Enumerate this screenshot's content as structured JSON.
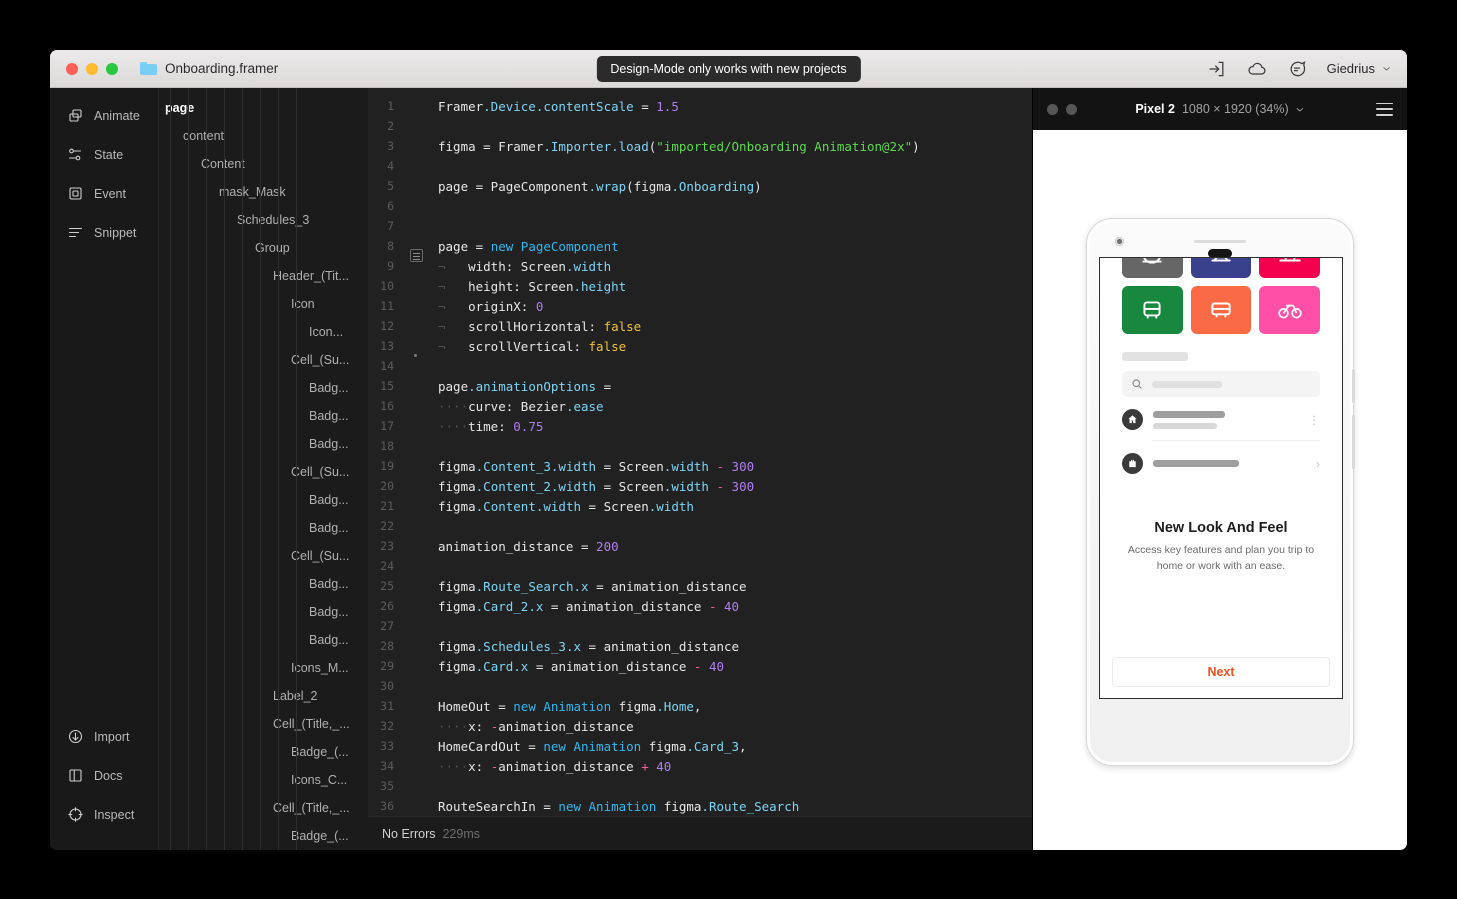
{
  "titlebar": {
    "document_name": "Onboarding.framer",
    "mode_notice": "Design-Mode only works with new projects",
    "icons": [
      "export-icon",
      "cloud-icon",
      "comment-icon"
    ],
    "user_name": "Giedrius"
  },
  "rail": {
    "top_items": [
      {
        "label": "Animate",
        "icon": "animate-icon"
      },
      {
        "label": "State",
        "icon": "state-icon"
      },
      {
        "label": "Event",
        "icon": "event-icon"
      },
      {
        "label": "Snippet",
        "icon": "snippet-icon"
      }
    ],
    "bottom_items": [
      {
        "label": "Import",
        "icon": "import-icon"
      },
      {
        "label": "Docs",
        "icon": "docs-icon"
      },
      {
        "label": "Inspect",
        "icon": "inspect-icon"
      }
    ]
  },
  "tree": {
    "items": [
      {
        "label": "page",
        "depth": 0,
        "root": true
      },
      {
        "label": "content",
        "depth": 1
      },
      {
        "label": "Content",
        "depth": 2
      },
      {
        "label": "mask_Mask",
        "depth": 3
      },
      {
        "label": "Schedules_3",
        "depth": 4
      },
      {
        "label": "Group",
        "depth": 5
      },
      {
        "label": "Header_(Tit...",
        "depth": 6
      },
      {
        "label": "Icon",
        "depth": 7
      },
      {
        "label": "Icon...",
        "depth": 8
      },
      {
        "label": "Cell_(Su...",
        "depth": 7
      },
      {
        "label": "Badg...",
        "depth": 8
      },
      {
        "label": "Badg...",
        "depth": 8
      },
      {
        "label": "Badg...",
        "depth": 8
      },
      {
        "label": "Cell_(Su...",
        "depth": 7
      },
      {
        "label": "Badg...",
        "depth": 8
      },
      {
        "label": "Badg...",
        "depth": 8
      },
      {
        "label": "Cell_(Su...",
        "depth": 7
      },
      {
        "label": "Badg...",
        "depth": 8
      },
      {
        "label": "Badg...",
        "depth": 8
      },
      {
        "label": "Badg...",
        "depth": 8
      },
      {
        "label": "Icons_M...",
        "depth": 7
      },
      {
        "label": "Label_2",
        "depth": 6
      },
      {
        "label": "Cell_(Title,_...",
        "depth": 6
      },
      {
        "label": "Badge_(...",
        "depth": 7
      },
      {
        "label": "Icons_C...",
        "depth": 7
      },
      {
        "label": "Cell_(Title,_...",
        "depth": 6
      },
      {
        "label": "Badge_(...",
        "depth": 7
      }
    ]
  },
  "editor": {
    "lines": [
      {
        "n": 1,
        "tokens": [
          [
            "plain",
            "Framer"
          ],
          [
            "prop",
            ".Device"
          ],
          [
            "prop",
            ".contentScale"
          ],
          [
            "plain",
            " = "
          ],
          [
            "num",
            "1.5"
          ]
        ]
      },
      {
        "n": 2,
        "tokens": []
      },
      {
        "n": 3,
        "tokens": [
          [
            "plain",
            "figma = Framer"
          ],
          [
            "prop",
            ".Importer"
          ],
          [
            "prop",
            ".load"
          ],
          [
            "plain",
            "("
          ],
          [
            "str",
            "\"imported/Onboarding Animation@2x\""
          ],
          [
            "plain",
            ")"
          ]
        ]
      },
      {
        "n": 4,
        "tokens": []
      },
      {
        "n": 5,
        "tokens": [
          [
            "plain",
            "page = PageComponent"
          ],
          [
            "prop",
            ".wrap"
          ],
          [
            "plain",
            "(figma"
          ],
          [
            "prop",
            ".Onboarding"
          ],
          [
            "plain",
            ")"
          ]
        ]
      },
      {
        "n": 6,
        "tokens": []
      },
      {
        "n": 7,
        "tokens": []
      },
      {
        "n": 8,
        "tokens": [
          [
            "plain",
            "page = "
          ],
          [
            "kw",
            "new"
          ],
          [
            "plain",
            " "
          ],
          [
            "kw",
            "PageComponent"
          ]
        ],
        "fold": "start"
      },
      {
        "n": 9,
        "tokens": [
          [
            "inv",
            "¬"
          ],
          [
            "plain",
            "   width: Screen"
          ],
          [
            "prop",
            ".width"
          ]
        ],
        "fold": "mid"
      },
      {
        "n": 10,
        "tokens": [
          [
            "inv",
            "¬"
          ],
          [
            "plain",
            "   height: Screen"
          ],
          [
            "prop",
            ".height"
          ]
        ],
        "fold": "mid"
      },
      {
        "n": 11,
        "tokens": [
          [
            "inv",
            "¬"
          ],
          [
            "plain",
            "   originX: "
          ],
          [
            "num",
            "0"
          ]
        ],
        "fold": "mid"
      },
      {
        "n": 12,
        "tokens": [
          [
            "inv",
            "¬"
          ],
          [
            "plain",
            "   scrollHorizontal: "
          ],
          [
            "bool",
            "false"
          ]
        ],
        "fold": "mid"
      },
      {
        "n": 13,
        "tokens": [
          [
            "inv",
            "¬"
          ],
          [
            "plain",
            "   scrollVertical: "
          ],
          [
            "bool",
            "false"
          ]
        ],
        "fold": "end"
      },
      {
        "n": 14,
        "tokens": []
      },
      {
        "n": 15,
        "tokens": [
          [
            "plain",
            "page"
          ],
          [
            "prop",
            ".animationOptions"
          ],
          [
            "plain",
            " ="
          ]
        ]
      },
      {
        "n": 16,
        "tokens": [
          [
            "inv",
            "····"
          ],
          [
            "plain",
            "curve: Bezier"
          ],
          [
            "prop",
            ".ease"
          ]
        ]
      },
      {
        "n": 17,
        "tokens": [
          [
            "inv",
            "····"
          ],
          [
            "plain",
            "time: "
          ],
          [
            "num",
            "0.75"
          ]
        ]
      },
      {
        "n": 18,
        "tokens": []
      },
      {
        "n": 19,
        "tokens": [
          [
            "plain",
            "figma"
          ],
          [
            "prop",
            ".Content_3"
          ],
          [
            "prop",
            ".width"
          ],
          [
            "plain",
            " = Screen"
          ],
          [
            "prop",
            ".width"
          ],
          [
            "plain",
            " "
          ],
          [
            "op",
            "-"
          ],
          [
            "plain",
            " "
          ],
          [
            "num",
            "300"
          ]
        ]
      },
      {
        "n": 20,
        "tokens": [
          [
            "plain",
            "figma"
          ],
          [
            "prop",
            ".Content_2"
          ],
          [
            "prop",
            ".width"
          ],
          [
            "plain",
            " = Screen"
          ],
          [
            "prop",
            ".width"
          ],
          [
            "plain",
            " "
          ],
          [
            "op",
            "-"
          ],
          [
            "plain",
            " "
          ],
          [
            "num",
            "300"
          ]
        ]
      },
      {
        "n": 21,
        "tokens": [
          [
            "plain",
            "figma"
          ],
          [
            "prop",
            ".Content"
          ],
          [
            "prop",
            ".width"
          ],
          [
            "plain",
            " = Screen"
          ],
          [
            "prop",
            ".width"
          ]
        ]
      },
      {
        "n": 22,
        "tokens": []
      },
      {
        "n": 23,
        "tokens": [
          [
            "plain",
            "animation_distance = "
          ],
          [
            "num",
            "200"
          ]
        ]
      },
      {
        "n": 24,
        "tokens": []
      },
      {
        "n": 25,
        "tokens": [
          [
            "plain",
            "figma"
          ],
          [
            "prop",
            ".Route_Search"
          ],
          [
            "prop",
            ".x"
          ],
          [
            "plain",
            " = animation_distance"
          ]
        ]
      },
      {
        "n": 26,
        "tokens": [
          [
            "plain",
            "figma"
          ],
          [
            "prop",
            ".Card_2"
          ],
          [
            "prop",
            ".x"
          ],
          [
            "plain",
            " = animation_distance "
          ],
          [
            "op",
            "-"
          ],
          [
            "plain",
            " "
          ],
          [
            "num",
            "40"
          ]
        ]
      },
      {
        "n": 27,
        "tokens": []
      },
      {
        "n": 28,
        "tokens": [
          [
            "plain",
            "figma"
          ],
          [
            "prop",
            ".Schedules_3"
          ],
          [
            "prop",
            ".x"
          ],
          [
            "plain",
            " = animation_distance"
          ]
        ]
      },
      {
        "n": 29,
        "tokens": [
          [
            "plain",
            "figma"
          ],
          [
            "prop",
            ".Card"
          ],
          [
            "prop",
            ".x"
          ],
          [
            "plain",
            " = animation_distance "
          ],
          [
            "op",
            "-"
          ],
          [
            "plain",
            " "
          ],
          [
            "num",
            "40"
          ]
        ]
      },
      {
        "n": 30,
        "tokens": []
      },
      {
        "n": 31,
        "tokens": [
          [
            "plain",
            "HomeOut = "
          ],
          [
            "kw",
            "new"
          ],
          [
            "plain",
            " "
          ],
          [
            "kw",
            "Animation"
          ],
          [
            "plain",
            " figma"
          ],
          [
            "prop",
            ".Home"
          ],
          [
            "plain",
            ","
          ]
        ]
      },
      {
        "n": 32,
        "tokens": [
          [
            "inv",
            "····"
          ],
          [
            "plain",
            "x: "
          ],
          [
            "op",
            "-"
          ],
          [
            "plain",
            "animation_distance"
          ]
        ]
      },
      {
        "n": 33,
        "tokens": [
          [
            "plain",
            "HomeCardOut = "
          ],
          [
            "kw",
            "new"
          ],
          [
            "plain",
            " "
          ],
          [
            "kw",
            "Animation"
          ],
          [
            "plain",
            " figma"
          ],
          [
            "prop",
            ".Card_3"
          ],
          [
            "plain",
            ","
          ]
        ]
      },
      {
        "n": 34,
        "tokens": [
          [
            "inv",
            "····"
          ],
          [
            "plain",
            "x: "
          ],
          [
            "op",
            "-"
          ],
          [
            "plain",
            "animation_distance "
          ],
          [
            "op",
            "+"
          ],
          [
            "plain",
            " "
          ],
          [
            "num",
            "40"
          ]
        ]
      },
      {
        "n": 35,
        "tokens": []
      },
      {
        "n": 36,
        "tokens": [
          [
            "plain",
            "RouteSearchIn = "
          ],
          [
            "kw",
            "new"
          ],
          [
            "plain",
            " "
          ],
          [
            "kw",
            "Animation"
          ],
          [
            "plain",
            " figma"
          ],
          [
            "prop",
            ".Route_Search"
          ]
        ]
      }
    ]
  },
  "statusbar": {
    "errors": "No Errors",
    "timing": "229ms"
  },
  "preview": {
    "device_name": "Pixel 2",
    "dimensions": "1080 × 1920 (34%)",
    "menu_icon": "hamburger-icon",
    "screen": {
      "tiles": [
        {
          "icon": "compass-icon",
          "color": "#666666"
        },
        {
          "icon": "train-icon",
          "color": "#39408c"
        },
        {
          "icon": "tram-icon",
          "color": "#f4004e"
        },
        {
          "icon": "bus-icon",
          "color": "#18883f"
        },
        {
          "icon": "minibus-icon",
          "color": "#fa6a44"
        },
        {
          "icon": "bike-icon",
          "color": "#ff4fa6"
        }
      ],
      "search_icon": "search-icon",
      "rows": [
        {
          "icon": "home-icon",
          "chevron": "⋮"
        },
        {
          "icon": "briefcase-icon",
          "chevron": "›"
        }
      ],
      "onboarding_title": "New Look And Feel",
      "onboarding_subtitle": "Access key features and plan you trip to home or work with an ease.",
      "next_label": "Next",
      "next_color": "#f4511e"
    }
  }
}
